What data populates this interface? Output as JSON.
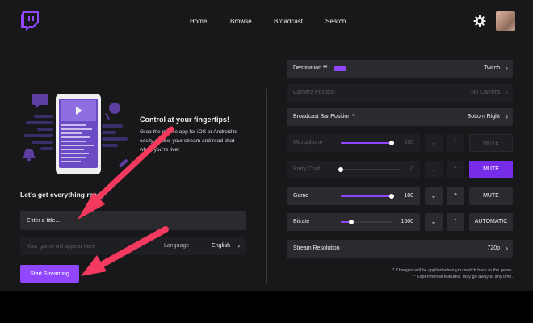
{
  "nav": {
    "links": [
      "Home",
      "Browse",
      "Broadcast",
      "Search"
    ],
    "icons": {
      "logo": "twitch-logo-icon",
      "settings": "gear-icon",
      "avatar": "user-avatar"
    }
  },
  "hero": {
    "title": "Control at your fingertips!",
    "body_lines": [
      "Grab the mobile app for iOS or Android to",
      "easily control your stream and read chat",
      "when you're live!"
    ]
  },
  "setup": {
    "heading": "Let's get everything ready",
    "title_placeholder": "Enter a title...",
    "game_placeholder": "Your game will appear here",
    "language_label": "Language",
    "language_value": "English",
    "start_button": "Start Streaming"
  },
  "settings": {
    "destination": {
      "label": "Destination **",
      "value": "Twitch"
    },
    "camera_position": {
      "label": "Camera Position",
      "value": "No Camera"
    },
    "bar_position": {
      "label": "Broadcast Bar Position *",
      "value": "Bottom Right"
    },
    "microphone": {
      "label": "Microphone",
      "value": "100",
      "level": 1.0,
      "action": "MUTE"
    },
    "party_chat": {
      "label": "Party Chat",
      "value": "0",
      "level": 0.0,
      "action": "MUTE"
    },
    "game": {
      "label": "Game",
      "value": "100",
      "level": 1.0,
      "action": "MUTE"
    },
    "bitrate": {
      "label": "Bitrate",
      "value": "1500",
      "level": 0.2,
      "action": "AUTOMATIC"
    },
    "resolution": {
      "label": "Stream Resolution",
      "value": "720p"
    }
  },
  "footnotes": {
    "line1": "* Changes will be applied when you switch back to the game.",
    "line2": "** Experimental features. May go away at any time."
  },
  "colors": {
    "accent": "#9147ff",
    "accent_dark": "#772ce8",
    "background": "#18181b",
    "panel": "#2b2b2f",
    "annotation": "#f4395e"
  }
}
